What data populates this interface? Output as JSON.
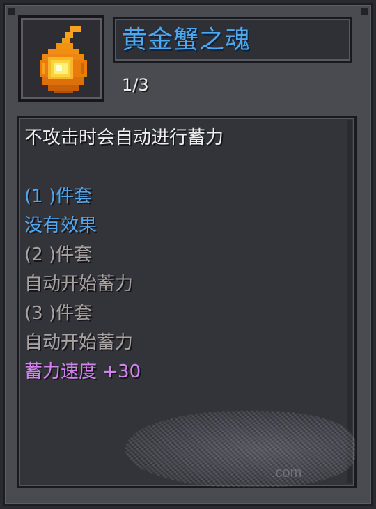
{
  "item": {
    "title": "黄金蟹之魂",
    "count": "1/3",
    "icon": "golden-flame-soul-icon"
  },
  "description": {
    "lines": [
      {
        "text": "不攻击时会自动进行蓄力",
        "color": "white"
      },
      {
        "text": "",
        "color": "white"
      },
      {
        "text": "(1 )件套",
        "color": "blue"
      },
      {
        "text": "没有效果",
        "color": "blue"
      },
      {
        "text": "(2 )件套",
        "color": "gray"
      },
      {
        "text": "自动开始蓄力",
        "color": "gray"
      },
      {
        "text": "(3 )件套",
        "color": "gray"
      },
      {
        "text": "自动开始蓄力",
        "color": "gray"
      },
      {
        "text": "蓄力速度 +30",
        "color": "purple"
      }
    ]
  },
  "watermark": {
    "text": ".com"
  },
  "colors": {
    "title": "#4ea8f0",
    "active_set": "#52a6ec",
    "inactive_set": "#a8a3a0",
    "bonus": "#d283f0",
    "panel": "#4a4a51"
  }
}
